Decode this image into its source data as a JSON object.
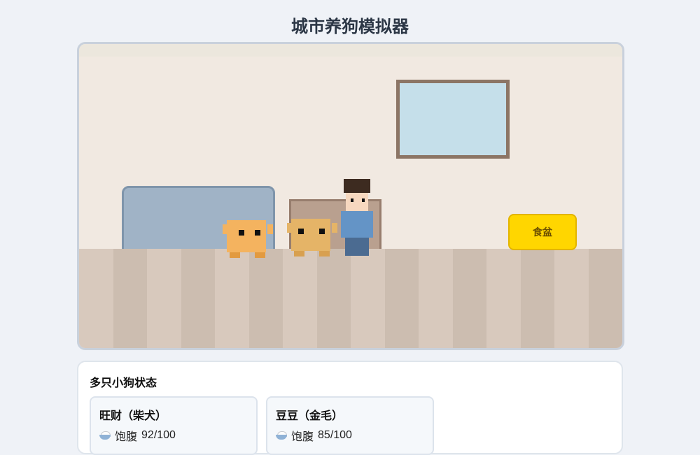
{
  "title": "城市养狗模拟器",
  "scene": {
    "food_bowl_label": "食盆"
  },
  "status": {
    "heading": "多只小狗状态",
    "dogs": [
      {
        "name": "旺财（柴犬）",
        "fullness_label": "饱腹",
        "fullness_value": "92/100",
        "icon": "rice-bowl-icon"
      },
      {
        "name": "豆豆（金毛）",
        "fullness_label": "饱腹",
        "fullness_value": "85/100",
        "icon": "rice-bowl-icon"
      }
    ]
  },
  "colors": {
    "food_bowl": "#ffd600",
    "dog_shiba": "#f4b35f",
    "dog_golden": "#e5b467",
    "sofa": "#a0b3c6"
  }
}
